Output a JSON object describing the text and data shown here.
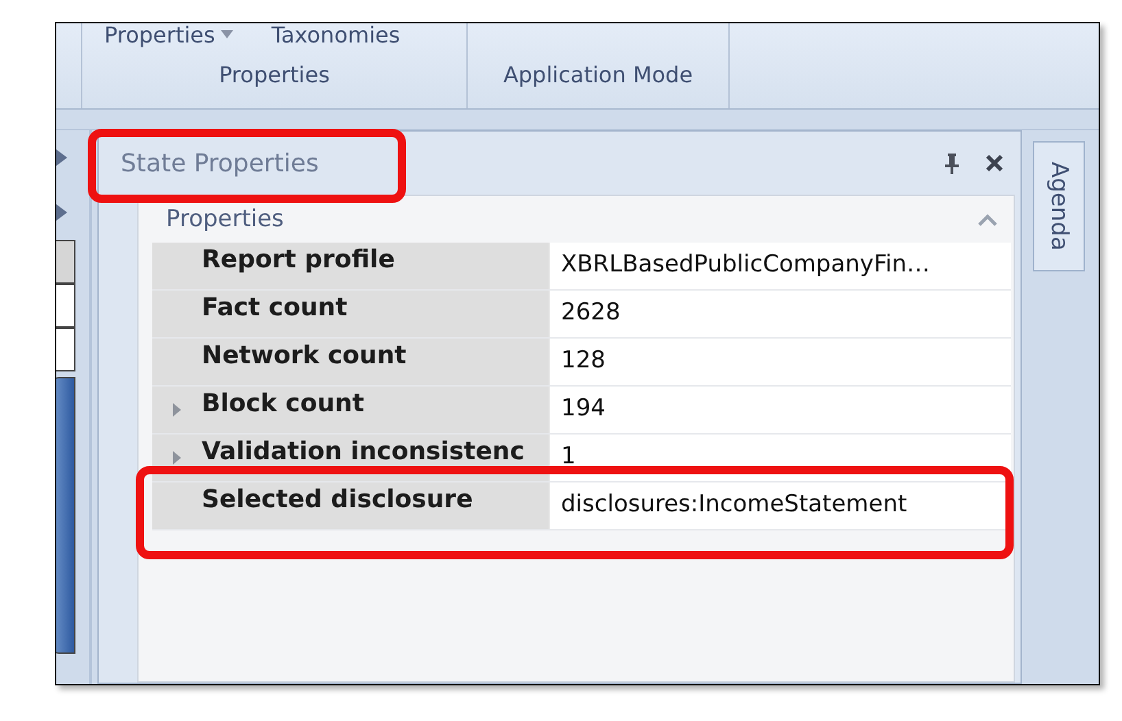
{
  "ribbon": {
    "tabs": [
      {
        "label": "Properties",
        "dropdown": true
      },
      {
        "label": "Taxonomies",
        "dropdown": false
      }
    ],
    "groups": [
      "Properties",
      "Application Mode"
    ]
  },
  "panel": {
    "title": "State Properties",
    "title_highlighted": true,
    "category": {
      "label": "Properties",
      "expanded": true
    },
    "rows": [
      {
        "name": "Report profile",
        "value": "XBRLBasedPublicCompanyFin…",
        "expandable": false,
        "highlighted": false
      },
      {
        "name": "Fact count",
        "value": "2628",
        "expandable": false,
        "highlighted": false
      },
      {
        "name": "Network count",
        "value": "128",
        "expandable": false,
        "highlighted": false
      },
      {
        "name": "Block count",
        "value": "194",
        "expandable": true,
        "highlighted": false
      },
      {
        "name": "Validation inconsistenc",
        "value": "1",
        "expandable": true,
        "highlighted": false
      },
      {
        "name": "Selected disclosure",
        "value": "disclosures:IncomeStatement",
        "expandable": false,
        "highlighted": true
      }
    ]
  },
  "side_tab": {
    "label": "Agenda"
  }
}
